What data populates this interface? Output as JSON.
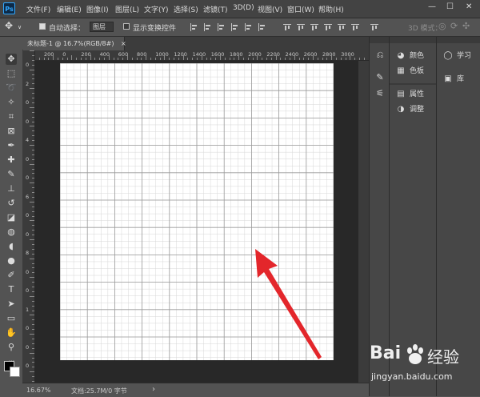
{
  "app": {
    "logo": "Ps"
  },
  "menu": [
    "文件(F)",
    "编辑(E)",
    "图像(I)",
    "图层(L)",
    "文字(Y)",
    "选择(S)",
    "滤镜(T)",
    "3D(D)",
    "视图(V)",
    "窗口(W)",
    "帮助(H)"
  ],
  "window_controls": {
    "minimize": "—",
    "restore": "☐",
    "close": "✕"
  },
  "options": {
    "auto_select_label": "自动选择：",
    "auto_select_checked": true,
    "auto_select_value": "图层",
    "show_transform_label": "显示变换控件",
    "show_transform_checked": false,
    "mode_3d_label": "3D 模式："
  },
  "document": {
    "tab_title": "未标题-1 @ 16.7%(RGB/8#)",
    "tab_close": "×"
  },
  "ruler": {
    "top_ticks": [
      "200",
      "0",
      "200",
      "400",
      "600",
      "800",
      "1000",
      "1200",
      "1400",
      "1600",
      "1800",
      "2000",
      "2200",
      "2400",
      "2600",
      "2800",
      "3000"
    ],
    "left_ticks": [
      "0",
      "2",
      "0",
      "0",
      "4",
      "0",
      "0",
      "6",
      "0",
      "0",
      "8",
      "0",
      "0",
      "1",
      "0",
      "0",
      "0"
    ]
  },
  "status": {
    "zoom": "16.67%",
    "doc_info": "文档:25.7M/0 字节",
    "arrow": "›"
  },
  "panels": {
    "group1": [
      {
        "icon": "color-wheel-icon",
        "glyph": "◕",
        "label": "颜色"
      },
      {
        "icon": "swatches-grid-icon",
        "glyph": "▦",
        "label": "色板"
      }
    ],
    "group2": [
      {
        "icon": "properties-icon",
        "glyph": "▤",
        "label": "属性"
      },
      {
        "icon": "adjustments-icon",
        "glyph": "◑",
        "label": "调整"
      }
    ],
    "group3": [
      {
        "icon": "learn-bulb-icon",
        "glyph": "◯",
        "label": "学习"
      },
      {
        "icon": "libraries-icon",
        "glyph": "▣",
        "label": "库"
      }
    ]
  },
  "colors": {
    "accent_blue": "#31a8ff",
    "arrow_red": "#e3262b",
    "canvas_grid_major": "#9a9a9a",
    "canvas_grid_minor": "#d7d7d7"
  },
  "watermark": {
    "brand_latin": "Bai",
    "brand_cn": "经验",
    "url": "jingyan.baidu.com"
  }
}
